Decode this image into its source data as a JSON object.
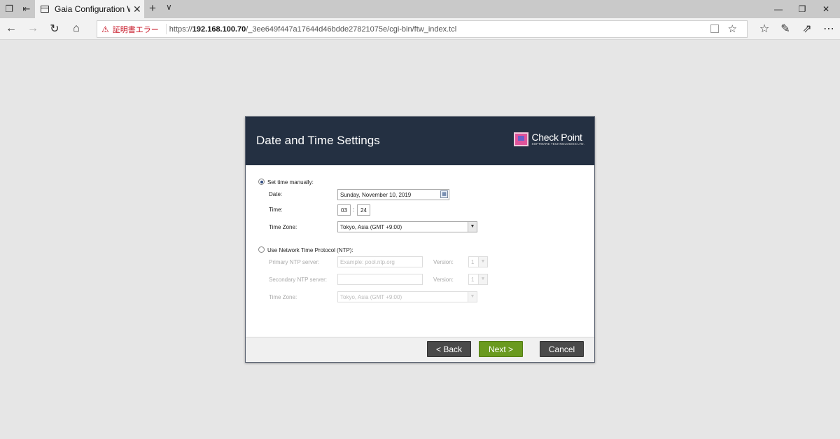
{
  "browser": {
    "tab_title": "Gaia Configuration Wiza",
    "cert_error": "証明書エラー",
    "url_scheme": "https://",
    "url_host": "192.168.100.70",
    "url_path": "/_3ee649f447a17644d46bdde27821075e/cgi-bin/ftw_index.tcl"
  },
  "dialog": {
    "title": "Date and Time Settings",
    "brand_name": "Check Point",
    "brand_sub": "SOFTWARE TECHNOLOGIES LTD.",
    "manual": {
      "label": "Set time manually:",
      "selected": true,
      "date_label": "Date:",
      "date_value": "Sunday, November 10, 2019",
      "time_label": "Time:",
      "hour": "03",
      "sep": ":",
      "minute": "24",
      "tz_label": "Time Zone:",
      "tz_value": "Tokyo, Asia (GMT +9:00)"
    },
    "ntp": {
      "label": "Use Network Time Protocol (NTP):",
      "selected": false,
      "primary_label": "Primary NTP server:",
      "primary_placeholder": "Example: pool.ntp.org",
      "secondary_label": "Secondary NTP server:",
      "secondary_value": "",
      "version_label": "Version:",
      "version_value": "1",
      "tz_label": "Time Zone:",
      "tz_value": "Tokyo, Asia (GMT +9:00)"
    },
    "buttons": {
      "back": "< Back",
      "next": "Next >",
      "cancel": "Cancel"
    }
  }
}
